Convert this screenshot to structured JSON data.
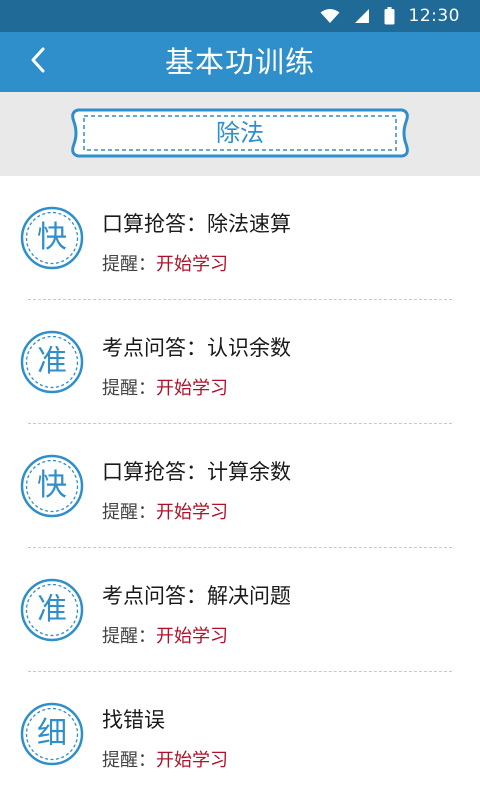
{
  "status_bar": {
    "time": "12:30",
    "icons": [
      "wifi-icon",
      "signal-icon",
      "battery-icon"
    ]
  },
  "header": {
    "title": "基本功训练",
    "back_icon": "chevron-left-icon"
  },
  "section": {
    "label": "除法"
  },
  "items": [
    {
      "badge": "快",
      "title": "口算抢答：除法速算",
      "hint_label": "提醒：",
      "hint_value": "开始学习"
    },
    {
      "badge": "准",
      "title": "考点问答：认识余数",
      "hint_label": "提醒：",
      "hint_value": "开始学习"
    },
    {
      "badge": "快",
      "title": "口算抢答：计算余数",
      "hint_label": "提醒：",
      "hint_value": "开始学习"
    },
    {
      "badge": "准",
      "title": "考点问答：解决问题",
      "hint_label": "提醒：",
      "hint_value": "开始学习"
    },
    {
      "badge": "细",
      "title": "找错误",
      "hint_label": "提醒：",
      "hint_value": "开始学习"
    }
  ],
  "colors": {
    "status_bar": "#1f6a96",
    "title_bar": "#2f8fca",
    "accent": "#2f8fca",
    "hint_value": "#b0102a",
    "band": "#e9e9e9"
  }
}
